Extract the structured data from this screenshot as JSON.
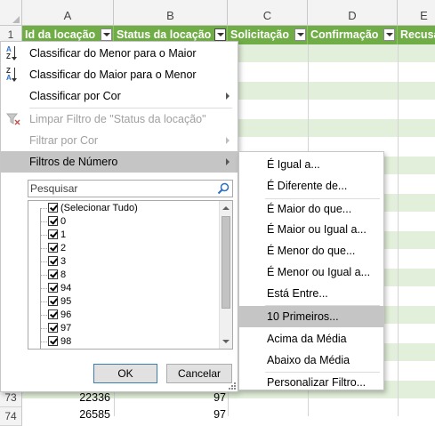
{
  "sheet": {
    "columns": [
      "A",
      "B",
      "C",
      "D",
      "E"
    ],
    "headers": [
      "Id da locação",
      "Status da locação",
      "Solicitação",
      "Confirmação",
      "Recusa"
    ],
    "row_numbers": [
      "1",
      "73",
      "74"
    ],
    "rows": [
      {
        "a": "22336",
        "b": "97"
      },
      {
        "a": "26585",
        "b": "97"
      }
    ]
  },
  "filter_menu": {
    "sort_asc": "Classificar do Menor para o Maior",
    "sort_desc": "Classificar do Maior para o Menor",
    "sort_by_color": "Classificar por Cor",
    "clear_filter": "Limpar Filtro de \"Status da locação\"",
    "filter_by_color": "Filtrar por Cor",
    "number_filters": "Filtros de Número",
    "search_placeholder": "Pesquisar",
    "items": [
      "(Selecionar Tudo)",
      "0",
      "1",
      "2",
      "3",
      "8",
      "94",
      "95",
      "96",
      "97",
      "98"
    ],
    "ok": "OK",
    "cancel": "Cancelar"
  },
  "number_filter_submenu": {
    "items": [
      "É Igual a...",
      "É Diferente de...",
      "É Maior do que...",
      "É Maior ou Igual a...",
      "É Menor do que...",
      "É Menor ou Igual a...",
      "Está Entre...",
      "10 Primeiros...",
      "Acima da Média",
      "Abaixo da Média",
      "Personalizar Filtro..."
    ],
    "highlighted": "10 Primeiros..."
  },
  "icons": [
    "sort-asc-icon",
    "sort-desc-icon",
    "clear-filter-icon",
    "search-icon",
    "dropdown-arrow-icon"
  ],
  "colors": {
    "header_green": "#70ad47",
    "band_green": "#e2efda",
    "highlight": "#c5c5c5"
  }
}
